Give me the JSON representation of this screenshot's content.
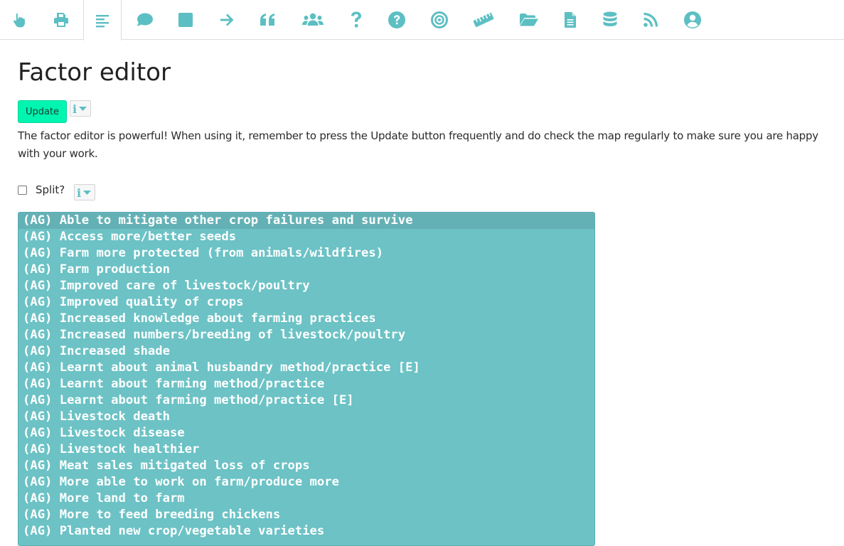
{
  "toolbar": {
    "tools": [
      {
        "icon": "hand-pointer-icon"
      },
      {
        "icon": "print-icon"
      },
      {
        "icon": "align-left-icon",
        "active": true
      },
      {
        "icon": "comment-icon"
      },
      {
        "icon": "square-icon"
      },
      {
        "icon": "arrow-right-icon"
      },
      {
        "icon": "quote-icon"
      },
      {
        "icon": "users-icon"
      },
      {
        "icon": "question-icon"
      },
      {
        "icon": "question-circle-icon"
      },
      {
        "icon": "bullseye-icon"
      },
      {
        "icon": "ruler-icon"
      },
      {
        "icon": "folder-open-icon"
      },
      {
        "icon": "file-text-icon"
      },
      {
        "icon": "database-icon"
      },
      {
        "icon": "rss-icon"
      },
      {
        "icon": "user-circle-icon"
      }
    ],
    "icon_color": "#5cbfc3"
  },
  "page": {
    "title": "Factor editor",
    "update_label": "Update",
    "info_glyph": "i",
    "description": "The factor editor is powerful! When using it, remember to press the Update button frequently and do check the map regularly to make sure you are happy with your work.",
    "split_label": "Split?",
    "split_checked": false
  },
  "colors": {
    "accent": "#00f5b0",
    "list_bg": "#6cc2c5",
    "list_selected_bg": "#64b1b5"
  },
  "factors": [
    "(AG) Able to mitigate other crop failures and survive",
    "(AG) Access more/better seeds",
    "(AG) Farm more protected (from animals/wildfires)",
    "(AG) Farm production",
    "(AG) Improved care of livestock/poultry",
    "(AG) Improved quality of crops",
    "(AG) Increased knowledge about farming practices",
    "(AG) Increased numbers/breeding of livestock/poultry",
    "(AG) Increased shade",
    "(AG) Learnt about animal husbandry method/practice [E]",
    "(AG) Learnt about farming method/practice",
    "(AG) Learnt about farming method/practice [E]",
    "(AG) Livestock death",
    "(AG) Livestock disease",
    "(AG) Livestock healthier",
    "(AG) Meat sales mitigated loss of crops",
    "(AG) More able to work on farm/produce more",
    "(AG) More land to farm",
    "(AG) More to feed breeding chickens",
    "(AG) Planted new crop/vegetable varieties"
  ]
}
